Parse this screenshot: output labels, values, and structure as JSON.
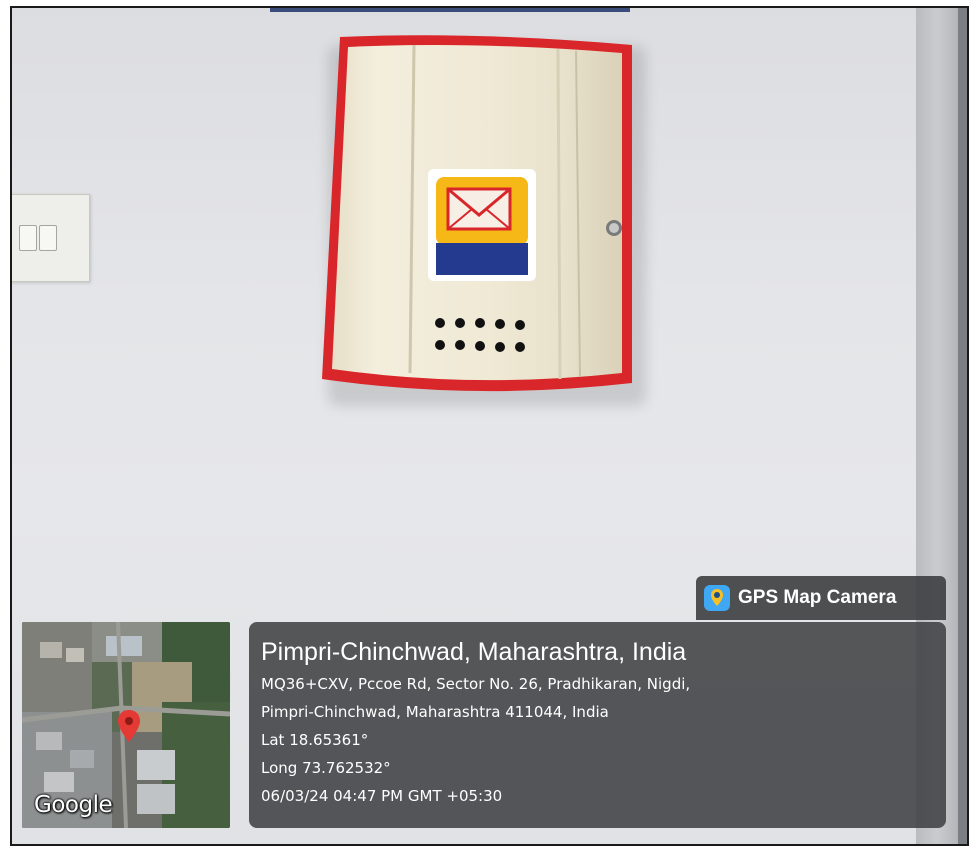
{
  "overlay": {
    "app_name": "GPS Map Camera",
    "app_icon": "map-pin-camera-icon",
    "location_title": "Pimpri-Chinchwad, Maharashtra, India",
    "address_line_1": "MQ36+CXV, Pccoe Rd, Sector No. 26, Pradhikaran, Nigdi,",
    "address_line_2": "Pimpri-Chinchwad, Maharashtra 411044, India",
    "latitude": "Lat 18.65361°",
    "longitude": "Long 73.762532°",
    "timestamp": "06/03/24 04:47 PM GMT +05:30",
    "map_attribution": "Google",
    "map_marker_icon": "red-map-pin-icon"
  },
  "scene": {
    "subject": "wall-mounted-postal-letter-box",
    "mailbox_icon": "envelope-icon",
    "colors": {
      "wall": "#e4e5e8",
      "mailbox_body": "#ece6d2",
      "mailbox_trim": "#d9262a",
      "emblem_yellow": "#f6b817",
      "emblem_blue": "#233a8f",
      "panel_bg": "#3c3e40"
    }
  }
}
